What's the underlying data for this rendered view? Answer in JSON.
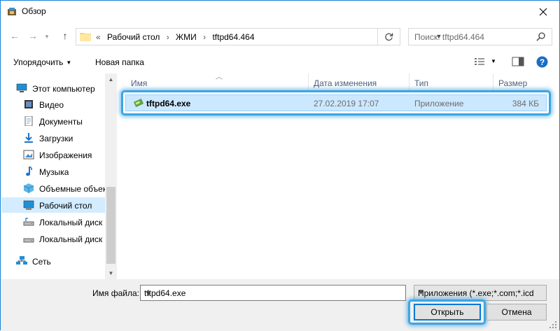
{
  "window": {
    "title": "Обзор"
  },
  "nav": {
    "crumbs_prefix": "«",
    "crumbs": [
      "Рабочий стол",
      "ЖМИ",
      "tftpd64.464"
    ],
    "separator": "›"
  },
  "search": {
    "placeholder": "Поиск: tftpd64.464"
  },
  "toolbar": {
    "organize_label": "Упорядочить",
    "new_folder_label": "Новая папка"
  },
  "sidebar": {
    "items": [
      {
        "label": "Этот компьютер",
        "icon": "computer-icon"
      },
      {
        "label": "Видео",
        "icon": "video-icon"
      },
      {
        "label": "Документы",
        "icon": "documents-icon"
      },
      {
        "label": "Загрузки",
        "icon": "downloads-icon"
      },
      {
        "label": "Изображения",
        "icon": "pictures-icon"
      },
      {
        "label": "Музыка",
        "icon": "music-icon"
      },
      {
        "label": "Объемные объекты",
        "icon": "3d-objects-icon"
      },
      {
        "label": "Рабочий стол",
        "icon": "desktop-icon",
        "selected": true
      },
      {
        "label": "Локальный диск",
        "icon": "drive-icon"
      },
      {
        "label": "Локальный диск",
        "icon": "drive-icon"
      },
      {
        "label": "Сеть",
        "icon": "network-icon"
      }
    ]
  },
  "columns": {
    "name": "Имя",
    "date": "Дата изменения",
    "type": "Тип",
    "size": "Размер"
  },
  "files": [
    {
      "name": "tftpd64.exe",
      "date": "27.02.2019 17:07",
      "type": "Приложение",
      "size": "384 КБ"
    }
  ],
  "bottom": {
    "filename_label": "Имя файла:",
    "filename_value": "tftpd64.exe",
    "filter_value": "Приложения (*.exe;*.com;*.icd)",
    "open_label": "Открыть",
    "cancel_label": "Отмена"
  },
  "colors": {
    "accent": "#0078d7",
    "selection": "#cce8ff",
    "highlight_ring": "#3aa7e0",
    "header_text": "#4c607a"
  }
}
